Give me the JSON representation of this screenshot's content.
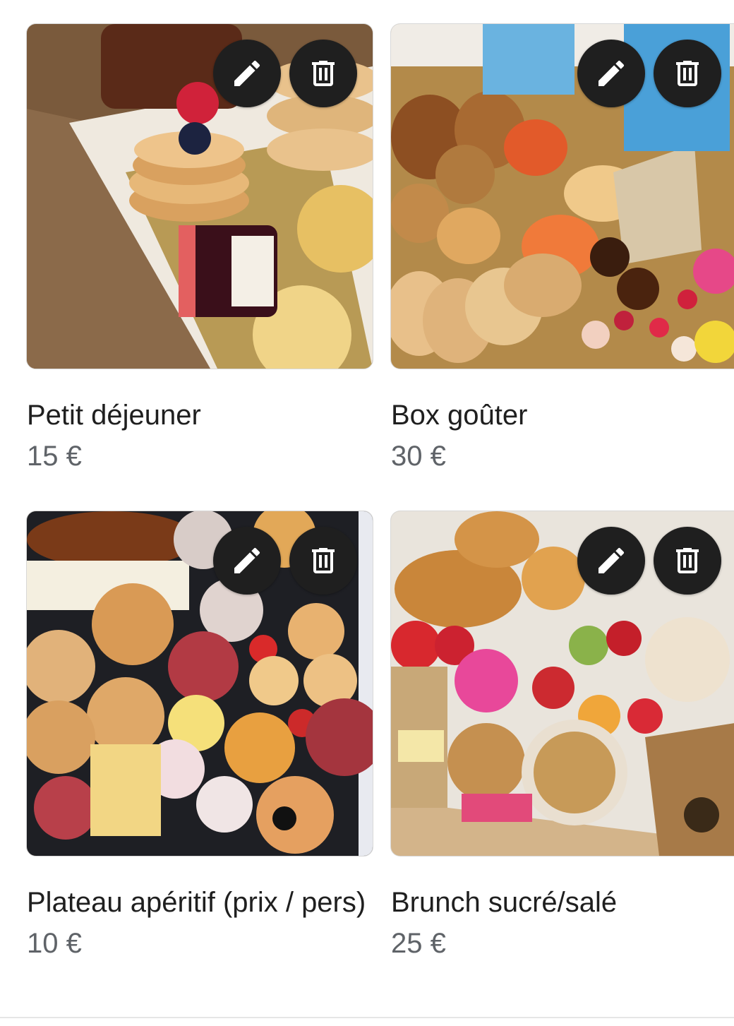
{
  "products": [
    {
      "title": "Petit déjeuner",
      "price": "15 €",
      "image_alt": "Breakfast box with mini pancakes, muffins and jam",
      "edit_icon": "pencil-icon",
      "delete_icon": "trash-icon"
    },
    {
      "title": "Box goûter",
      "price": "30 €",
      "image_alt": "Snack box with pastries, cookies, pancakes, candy and fruit",
      "edit_icon": "pencil-icon",
      "delete_icon": "trash-icon"
    },
    {
      "title": "Plateau apéritif (prix / pers)",
      "price": "10 €",
      "image_alt": "Aperitif platter with buns, charcuterie, cheese and dips",
      "edit_icon": "pencil-icon",
      "delete_icon": "trash-icon"
    },
    {
      "title": "Brunch sucré/salé",
      "price": "25 €",
      "image_alt": "Sweet and savory brunch box with croissants, fruit and granola",
      "edit_icon": "pencil-icon",
      "delete_icon": "trash-icon"
    }
  ],
  "colors": {
    "fab_background": "#1f1f1f",
    "title_text": "#1f1f1f",
    "price_text": "#5f6368"
  }
}
